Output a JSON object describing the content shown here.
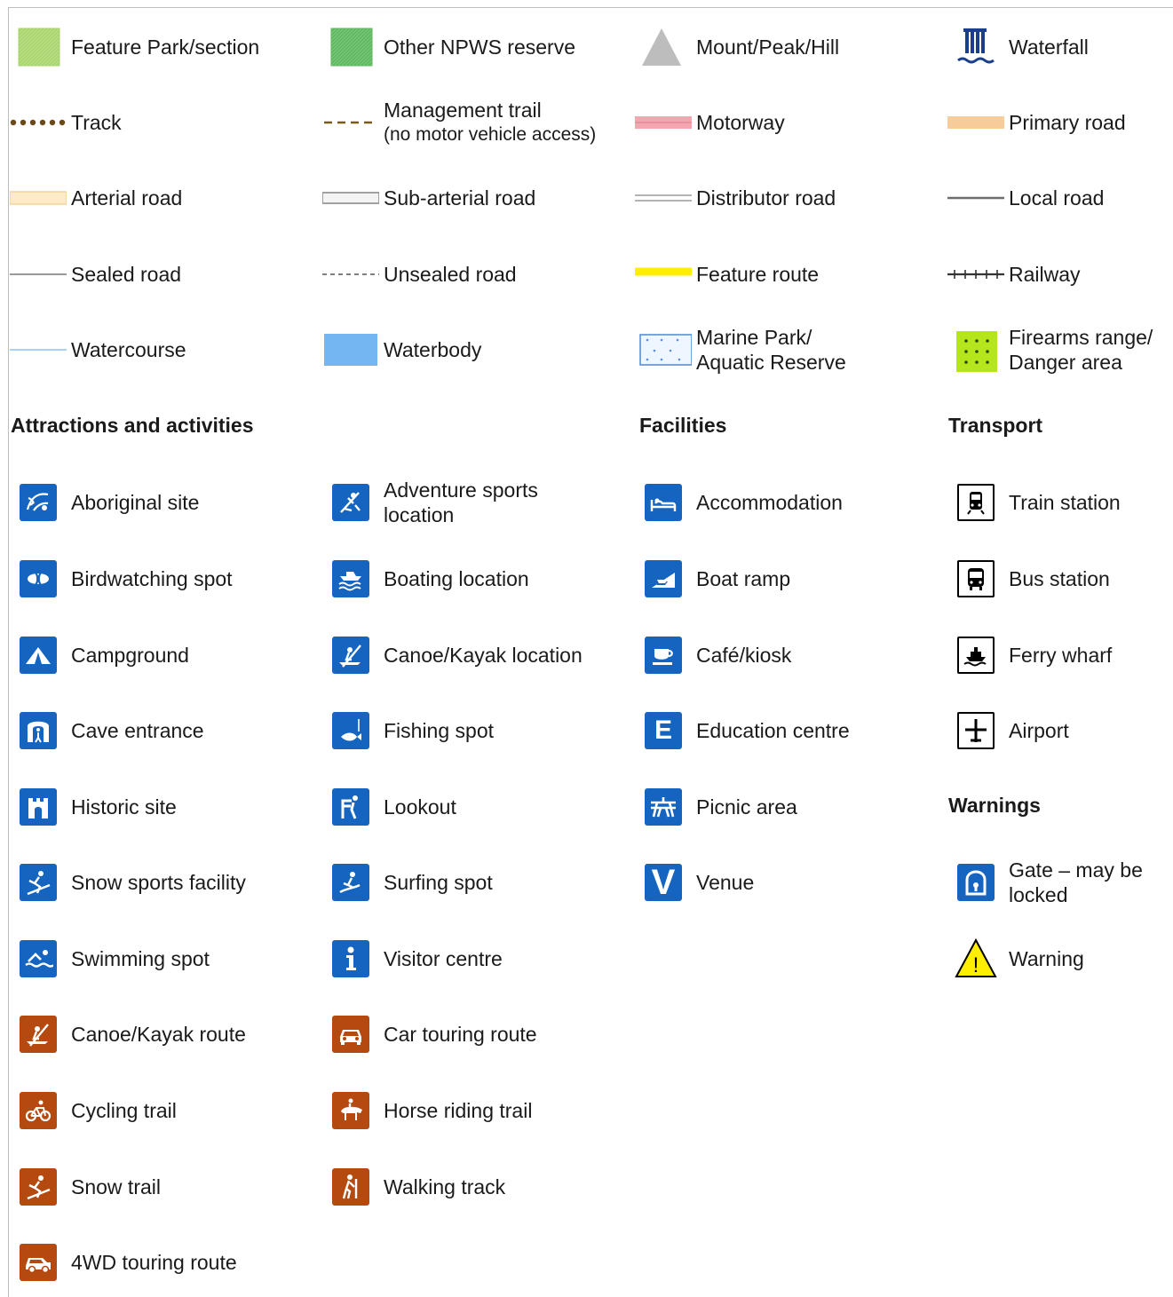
{
  "legend": [
    {
      "col": 0,
      "row": 0,
      "symbol": "feature-park-swatch",
      "color": "#a8d56b",
      "lines": [
        "Feature Park/section"
      ]
    },
    {
      "col": 1,
      "row": 0,
      "symbol": "npws-reserve-swatch",
      "color": "#5cb85c",
      "lines": [
        "Other NPWS reserve"
      ]
    },
    {
      "col": 2,
      "row": 0,
      "symbol": "peak-triangle-icon",
      "color": "#bdbdbd",
      "lines": [
        "Mount/Peak/Hill"
      ]
    },
    {
      "col": 3,
      "row": 0,
      "symbol": "waterfall-icon",
      "color": "#1a3e8c",
      "lines": [
        "Waterfall"
      ]
    },
    {
      "col": 0,
      "row": 1,
      "symbol": "track-dotted-line",
      "color": "#6b4a1a",
      "lines": [
        "Track"
      ]
    },
    {
      "col": 1,
      "row": 1,
      "symbol": "management-trail-dashed-line",
      "color": "#7a5a1a",
      "lines": [
        "Management trail",
        "(no motor vehicle access)"
      ]
    },
    {
      "col": 2,
      "row": 1,
      "symbol": "motorway-line",
      "color": "#f3a6b0",
      "lines": [
        "Motorway"
      ]
    },
    {
      "col": 3,
      "row": 1,
      "symbol": "primary-road-line",
      "color": "#f8cc98",
      "lines": [
        "Primary road"
      ]
    },
    {
      "col": 0,
      "row": 2,
      "symbol": "arterial-road-line",
      "color": "#f5d39b",
      "lines": [
        "Arterial road"
      ]
    },
    {
      "col": 1,
      "row": 2,
      "symbol": "sub-arterial-road-line",
      "color": "#8c8c8c",
      "lines": [
        "Sub-arterial road"
      ]
    },
    {
      "col": 2,
      "row": 2,
      "symbol": "distributor-road-line",
      "color": "#9a9a9a",
      "lines": [
        "Distributor road"
      ]
    },
    {
      "col": 3,
      "row": 2,
      "symbol": "local-road-line",
      "color": "#6e6e6e",
      "lines": [
        "Local road"
      ]
    },
    {
      "col": 0,
      "row": 3,
      "symbol": "sealed-road-line",
      "color": "#777777",
      "lines": [
        "Sealed road"
      ]
    },
    {
      "col": 1,
      "row": 3,
      "symbol": "unsealed-road-line",
      "color": "#555555",
      "lines": [
        "Unsealed road"
      ]
    },
    {
      "col": 2,
      "row": 3,
      "symbol": "feature-route-line",
      "color": "#ffee00",
      "lines": [
        "Feature route"
      ]
    },
    {
      "col": 3,
      "row": 3,
      "symbol": "railway-line",
      "color": "#333333",
      "lines": [
        "Railway"
      ]
    },
    {
      "col": 0,
      "row": 4,
      "symbol": "watercourse-line",
      "color": "#9fc9ee",
      "lines": [
        "Watercourse"
      ]
    },
    {
      "col": 1,
      "row": 4,
      "symbol": "waterbody-swatch",
      "color": "#74b6f2",
      "lines": [
        "Waterbody"
      ]
    },
    {
      "col": 2,
      "row": 4,
      "symbol": "marine-park-swatch",
      "color": "#5b8fd0",
      "lines": [
        "Marine Park/",
        "Aquatic Reserve"
      ]
    },
    {
      "col": 3,
      "row": 4,
      "symbol": "firearms-range-swatch",
      "color": "#b5e61d",
      "lines": [
        "Firearms range/",
        "Danger area"
      ]
    },
    {
      "col": 0,
      "row": 6,
      "symbol": "aboriginal-site-icon",
      "style": "blue",
      "lines": [
        "Aboriginal site"
      ]
    },
    {
      "col": 1,
      "row": 6,
      "symbol": "adventure-sports-icon",
      "style": "blue",
      "lines": [
        "Adventure sports",
        "location"
      ]
    },
    {
      "col": 2,
      "row": 6,
      "symbol": "accommodation-icon",
      "style": "blue",
      "lines": [
        "Accommodation"
      ]
    },
    {
      "col": 3,
      "row": 6,
      "symbol": "train-station-icon",
      "style": "transport",
      "lines": [
        "Train station"
      ]
    },
    {
      "col": 0,
      "row": 7,
      "symbol": "birdwatching-icon",
      "style": "blue",
      "lines": [
        "Birdwatching spot"
      ]
    },
    {
      "col": 1,
      "row": 7,
      "symbol": "boating-icon",
      "style": "blue",
      "lines": [
        "Boating location"
      ]
    },
    {
      "col": 2,
      "row": 7,
      "symbol": "boat-ramp-icon",
      "style": "blue",
      "lines": [
        "Boat ramp"
      ]
    },
    {
      "col": 3,
      "row": 7,
      "symbol": "bus-station-icon",
      "style": "transport",
      "lines": [
        "Bus station"
      ]
    },
    {
      "col": 0,
      "row": 8,
      "symbol": "campground-icon",
      "style": "blue",
      "lines": [
        "Campground"
      ]
    },
    {
      "col": 1,
      "row": 8,
      "symbol": "canoe-kayak-location-icon",
      "style": "blue",
      "lines": [
        "Canoe/Kayak location"
      ]
    },
    {
      "col": 2,
      "row": 8,
      "symbol": "cafe-kiosk-icon",
      "style": "blue",
      "lines": [
        "Café/kiosk"
      ]
    },
    {
      "col": 3,
      "row": 8,
      "symbol": "ferry-wharf-icon",
      "style": "transport",
      "lines": [
        "Ferry wharf"
      ]
    },
    {
      "col": 0,
      "row": 9,
      "symbol": "cave-entrance-icon",
      "style": "blue",
      "lines": [
        "Cave entrance"
      ]
    },
    {
      "col": 1,
      "row": 9,
      "symbol": "fishing-spot-icon",
      "style": "blue",
      "lines": [
        "Fishing spot"
      ]
    },
    {
      "col": 2,
      "row": 9,
      "symbol": "education-centre-icon",
      "style": "blue",
      "glyph": "E",
      "lines": [
        "Education centre"
      ]
    },
    {
      "col": 3,
      "row": 9,
      "symbol": "airport-icon",
      "style": "transport",
      "lines": [
        "Airport"
      ]
    },
    {
      "col": 0,
      "row": 10,
      "symbol": "historic-site-icon",
      "style": "blue",
      "lines": [
        "Historic site"
      ]
    },
    {
      "col": 1,
      "row": 10,
      "symbol": "lookout-icon",
      "style": "blue",
      "lines": [
        "Lookout"
      ]
    },
    {
      "col": 2,
      "row": 10,
      "symbol": "picnic-area-icon",
      "style": "blue",
      "lines": [
        "Picnic area"
      ]
    },
    {
      "col": 0,
      "row": 11,
      "symbol": "snow-sports-facility-icon",
      "style": "blue",
      "lines": [
        "Snow sports facility"
      ]
    },
    {
      "col": 1,
      "row": 11,
      "symbol": "surfing-spot-icon",
      "style": "blue",
      "lines": [
        "Surfing spot"
      ]
    },
    {
      "col": 2,
      "row": 11,
      "symbol": "venue-icon",
      "style": "blue",
      "glyph": "V",
      "lines": [
        "Venue"
      ]
    },
    {
      "col": 3,
      "row": 11,
      "symbol": "gate-locked-icon",
      "style": "blue",
      "lines": [
        "Gate – may be",
        "locked"
      ]
    },
    {
      "col": 0,
      "row": 12,
      "symbol": "swimming-spot-icon",
      "style": "blue",
      "lines": [
        "Swimming spot"
      ]
    },
    {
      "col": 1,
      "row": 12,
      "symbol": "visitor-centre-icon",
      "style": "blue",
      "lines": [
        "Visitor centre"
      ]
    },
    {
      "col": 3,
      "row": 12,
      "symbol": "warning-triangle-icon",
      "style": "warning",
      "lines": [
        "Warning"
      ]
    },
    {
      "col": 0,
      "row": 13,
      "symbol": "canoe-kayak-route-icon",
      "style": "brown",
      "lines": [
        "Canoe/Kayak route"
      ]
    },
    {
      "col": 1,
      "row": 13,
      "symbol": "car-touring-route-icon",
      "style": "brown",
      "lines": [
        "Car touring route"
      ]
    },
    {
      "col": 0,
      "row": 14,
      "symbol": "cycling-trail-icon",
      "style": "brown",
      "lines": [
        "Cycling trail"
      ]
    },
    {
      "col": 1,
      "row": 14,
      "symbol": "horse-riding-trail-icon",
      "style": "brown",
      "lines": [
        "Horse riding trail"
      ]
    },
    {
      "col": 0,
      "row": 15,
      "symbol": "snow-trail-icon",
      "style": "brown",
      "lines": [
        "Snow trail"
      ]
    },
    {
      "col": 1,
      "row": 15,
      "symbol": "walking-track-icon",
      "style": "brown",
      "lines": [
        "Walking track"
      ]
    },
    {
      "col": 0,
      "row": 16,
      "symbol": "4wd-touring-route-icon",
      "style": "brown",
      "lines": [
        "4WD touring route"
      ]
    }
  ],
  "headings": [
    {
      "col": 0,
      "row": 5,
      "text": "Attractions and activities"
    },
    {
      "col": 2,
      "row": 5,
      "text": "Facilities"
    },
    {
      "col": 3,
      "row": 5,
      "text": "Transport"
    },
    {
      "col": 3,
      "row": 10,
      "text": "Warnings"
    }
  ],
  "colors": {
    "blue_icon": "#1565c0",
    "brown_icon": "#b44a10",
    "transport_border": "#000000",
    "warning_fill": "#ffee00"
  }
}
